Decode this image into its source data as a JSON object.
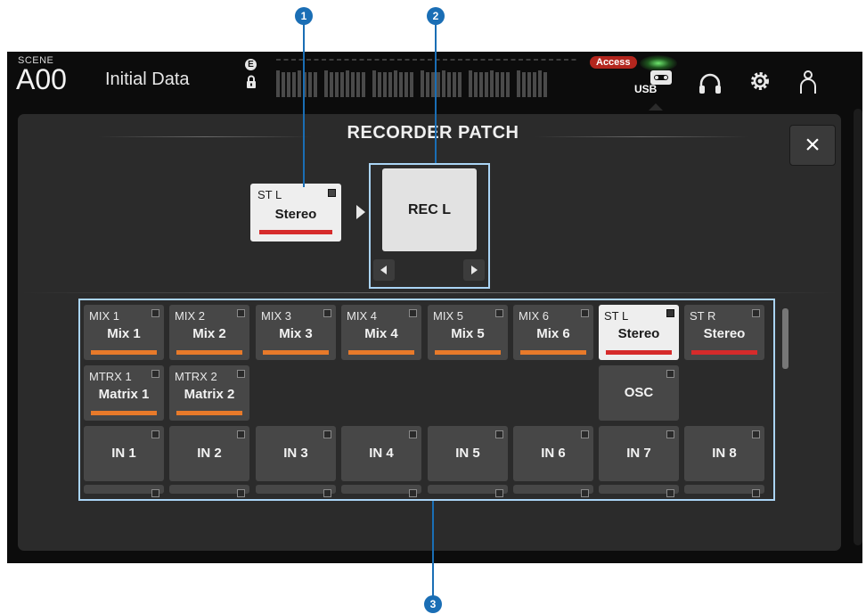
{
  "header": {
    "scene_label": "SCENE",
    "scene_number": "A00",
    "scene_title": "Initial Data",
    "e_badge": "E",
    "access_badge": "Access",
    "usb_label": "USB",
    "icons": [
      "lock-icon",
      "usb-recorder-icon",
      "headphones-icon",
      "gear-icon",
      "user-icon"
    ]
  },
  "panel": {
    "title": "RECORDER PATCH",
    "close_label": "×"
  },
  "source": {
    "name": "ST L",
    "label": "Stereo",
    "bar_color": "#d62b2b"
  },
  "destination": {
    "label": "REC L"
  },
  "grid": {
    "row1": [
      {
        "name": "MIX 1",
        "label": "Mix 1",
        "bar": "#e87a2a",
        "active": false
      },
      {
        "name": "MIX 2",
        "label": "Mix 2",
        "bar": "#e87a2a",
        "active": false
      },
      {
        "name": "MIX 3",
        "label": "Mix 3",
        "bar": "#e87a2a",
        "active": false
      },
      {
        "name": "MIX 4",
        "label": "Mix 4",
        "bar": "#e87a2a",
        "active": false
      },
      {
        "name": "MIX 5",
        "label": "Mix 5",
        "bar": "#e87a2a",
        "active": false
      },
      {
        "name": "MIX 6",
        "label": "Mix 6",
        "bar": "#e87a2a",
        "active": false
      },
      {
        "name": "ST L",
        "label": "Stereo",
        "bar": "#d62b2b",
        "active": true
      },
      {
        "name": "ST R",
        "label": "Stereo",
        "bar": "#d62b2b",
        "active": false
      }
    ],
    "row2": [
      {
        "name": "MTRX 1",
        "label": "Matrix 1",
        "bar": "#e87a2a"
      },
      {
        "name": "MTRX 2",
        "label": "Matrix 2",
        "bar": "#e87a2a"
      }
    ],
    "osc_label": "OSC",
    "row3": [
      "IN 1",
      "IN 2",
      "IN 3",
      "IN 4",
      "IN 5",
      "IN 6",
      "IN 7",
      "IN 8"
    ]
  },
  "callouts": [
    "1",
    "2",
    "3"
  ],
  "colors": {
    "highlight_frame": "#aad4f5",
    "callout": "#1a6eb5",
    "access_badge": "#b3261e"
  }
}
